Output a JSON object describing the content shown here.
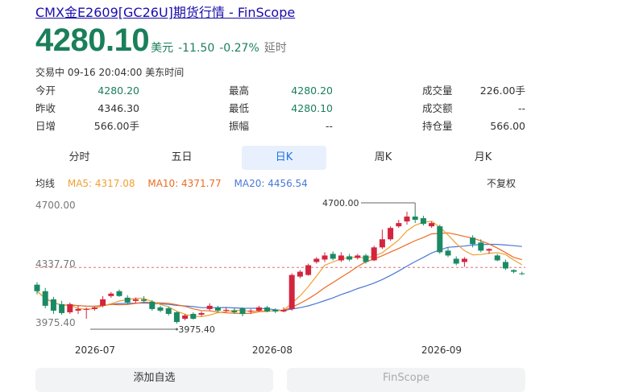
{
  "page_title": "CMX金E2609[GC26U]期货行情 - FinScope",
  "quote": {
    "price": "4280.10",
    "currency": "美元",
    "change": "-11.50",
    "change_pct": "-0.27%",
    "delay_label": "延时",
    "status_line": "交易中 09-16 20:04:00 美东时间"
  },
  "stats": {
    "col1": [
      {
        "label": "今开",
        "value": "4280.20"
      },
      {
        "label": "昨收",
        "value": "4346.30"
      },
      {
        "label": "日增",
        "value": "566.00手"
      }
    ],
    "col2": [
      {
        "label": "最高",
        "value": "4280.20"
      },
      {
        "label": "最低",
        "value": "4280.10"
      },
      {
        "label": "振幅",
        "value": "--"
      }
    ],
    "col3": [
      {
        "label": "成交量",
        "value": "226.00手"
      },
      {
        "label": "成交额",
        "value": "--"
      },
      {
        "label": "持仓量",
        "value": "566.00"
      }
    ]
  },
  "tabs": [
    "分时",
    "五日",
    "日K",
    "周K",
    "月K"
  ],
  "active_tab": "日K",
  "ma_legend": {
    "label": "均线",
    "ma5": "MA5: 4317.08",
    "ma10": "MA10: 4371.77",
    "ma20": "MA20: 4456.54",
    "adjust": "不复权"
  },
  "buttons": {
    "add_watchlist": "添加自选",
    "second": "FinScope"
  },
  "chart_data": {
    "type": "candlestick",
    "y_tick_labels": [
      "4700.00",
      "4337.70",
      "3975.40"
    ],
    "ylim": [
      3975.4,
      4700.0
    ],
    "x_tick_labels": [
      "2026-07",
      "2026-08",
      "2026-09"
    ],
    "annotations": {
      "high": "4700.00",
      "low": "3975.40"
    },
    "reference_line": 4346.3,
    "colors": {
      "up": "#d3253e",
      "down": "#1a8a64",
      "ma5": "#f0a030",
      "ma10": "#ee6a20",
      "ma20": "#4a78d6"
    },
    "candles": [
      {
        "o": 4240,
        "c": 4200,
        "h": 4255,
        "l": 4180
      },
      {
        "o": 4200,
        "c": 4110,
        "h": 4220,
        "l": 4095
      },
      {
        "o": 4150,
        "c": 4080,
        "h": 4165,
        "l": 4060
      },
      {
        "o": 4120,
        "c": 4065,
        "h": 4140,
        "l": 4055
      },
      {
        "o": 4070,
        "c": 4120,
        "h": 4130,
        "l": 4060
      },
      {
        "o": 4080,
        "c": 4090,
        "h": 4110,
        "l": 4060
      },
      {
        "o": 4085,
        "c": 4090,
        "h": 4100,
        "l": 4030
      },
      {
        "o": 4090,
        "c": 4100,
        "h": 4105,
        "l": 4080
      },
      {
        "o": 4110,
        "c": 4150,
        "h": 4170,
        "l": 4100
      },
      {
        "o": 4170,
        "c": 4185,
        "h": 4195,
        "l": 4160
      },
      {
        "o": 4200,
        "c": 4170,
        "h": 4210,
        "l": 4165
      },
      {
        "o": 4160,
        "c": 4130,
        "h": 4175,
        "l": 4120
      },
      {
        "o": 4140,
        "c": 4150,
        "h": 4160,
        "l": 4125
      },
      {
        "o": 4150,
        "c": 4140,
        "h": 4170,
        "l": 4130
      },
      {
        "o": 4135,
        "c": 4090,
        "h": 4145,
        "l": 4080
      },
      {
        "o": 4100,
        "c": 4080,
        "h": 4110,
        "l": 4070
      },
      {
        "o": 4095,
        "c": 4060,
        "h": 4105,
        "l": 4050
      },
      {
        "o": 4070,
        "c": 4010,
        "h": 4075,
        "l": 4000
      },
      {
        "o": 4030,
        "c": 4050,
        "h": 4060,
        "l": 4020
      },
      {
        "o": 4060,
        "c": 4030,
        "h": 4070,
        "l": 4025
      },
      {
        "o": 4055,
        "c": 4065,
        "h": 4075,
        "l": 4045
      },
      {
        "o": 4090,
        "c": 4110,
        "h": 4125,
        "l": 4080
      },
      {
        "o": 4100,
        "c": 4080,
        "h": 4110,
        "l": 4070
      },
      {
        "o": 4080,
        "c": 4085,
        "h": 4100,
        "l": 4070
      },
      {
        "o": 4080,
        "c": 4070,
        "h": 4095,
        "l": 4060
      },
      {
        "o": 4095,
        "c": 4060,
        "h": 4100,
        "l": 4045
      },
      {
        "o": 4075,
        "c": 4080,
        "h": 4090,
        "l": 4060
      },
      {
        "o": 4080,
        "c": 4100,
        "h": 4110,
        "l": 4075
      },
      {
        "o": 4100,
        "c": 4075,
        "h": 4110,
        "l": 4070
      },
      {
        "o": 4085,
        "c": 4075,
        "h": 4095,
        "l": 4065
      },
      {
        "o": 4075,
        "c": 4085,
        "h": 4100,
        "l": 4070
      },
      {
        "o": 4090,
        "c": 4300,
        "h": 4310,
        "l": 4080
      },
      {
        "o": 4290,
        "c": 4320,
        "h": 4330,
        "l": 4280
      },
      {
        "o": 4300,
        "c": 4360,
        "h": 4370,
        "l": 4295
      },
      {
        "o": 4380,
        "c": 4400,
        "h": 4410,
        "l": 4370
      },
      {
        "o": 4395,
        "c": 4420,
        "h": 4440,
        "l": 4380
      },
      {
        "o": 4430,
        "c": 4400,
        "h": 4445,
        "l": 4390
      },
      {
        "o": 4390,
        "c": 4420,
        "h": 4440,
        "l": 4380
      },
      {
        "o": 4415,
        "c": 4395,
        "h": 4430,
        "l": 4385
      },
      {
        "o": 4405,
        "c": 4420,
        "h": 4430,
        "l": 4395
      },
      {
        "o": 4420,
        "c": 4380,
        "h": 4430,
        "l": 4370
      },
      {
        "o": 4390,
        "c": 4470,
        "h": 4480,
        "l": 4385
      },
      {
        "o": 4470,
        "c": 4520,
        "h": 4580,
        "l": 4460
      },
      {
        "o": 4520,
        "c": 4590,
        "h": 4600,
        "l": 4510
      },
      {
        "o": 4600,
        "c": 4620,
        "h": 4640,
        "l": 4590
      },
      {
        "o": 4630,
        "c": 4660,
        "h": 4690,
        "l": 4610
      },
      {
        "o": 4660,
        "c": 4640,
        "h": 4700,
        "l": 4620
      },
      {
        "o": 4650,
        "c": 4615,
        "h": 4665,
        "l": 4605
      },
      {
        "o": 4600,
        "c": 4620,
        "h": 4630,
        "l": 4590
      },
      {
        "o": 4600,
        "c": 4440,
        "h": 4610,
        "l": 4430
      },
      {
        "o": 4450,
        "c": 4420,
        "h": 4470,
        "l": 4410
      },
      {
        "o": 4400,
        "c": 4370,
        "h": 4415,
        "l": 4360
      },
      {
        "o": 4380,
        "c": 4400,
        "h": 4410,
        "l": 4350
      },
      {
        "o": 4530,
        "c": 4490,
        "h": 4545,
        "l": 4470
      },
      {
        "o": 4500,
        "c": 4450,
        "h": 4520,
        "l": 4440
      },
      {
        "o": 4450,
        "c": 4460,
        "h": 4465,
        "l": 4430
      },
      {
        "o": 4420,
        "c": 4390,
        "h": 4430,
        "l": 4385
      },
      {
        "o": 4380,
        "c": 4340,
        "h": 4395,
        "l": 4330
      },
      {
        "o": 4330,
        "c": 4320,
        "h": 4335,
        "l": 4310
      },
      {
        "o": 4310,
        "c": 4305,
        "h": 4320,
        "l": 4300
      }
    ]
  }
}
